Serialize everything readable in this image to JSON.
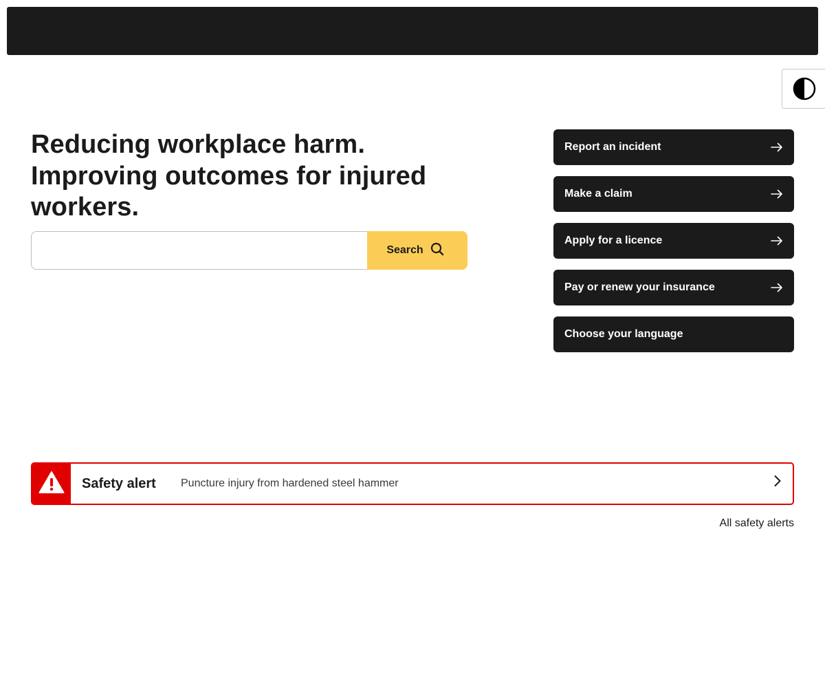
{
  "header": {
    "bar_color": "#1b1b1b"
  },
  "contrast_toggle": {
    "icon": "contrast-icon",
    "label": "Toggle high contrast"
  },
  "hero": {
    "title": "Reducing workplace harm. Improving outcomes for injured workers."
  },
  "search": {
    "value": "",
    "placeholder": "",
    "button_label": "Search",
    "button_icon": "search-icon",
    "button_color": "#fccd56"
  },
  "quick_links": [
    {
      "label": "Report an incident",
      "icon": "arrow-right-icon"
    },
    {
      "label": "Make a claim",
      "icon": "arrow-right-icon"
    },
    {
      "label": "Apply for a licence",
      "icon": "arrow-right-icon"
    },
    {
      "label": "Pay or renew your insurance",
      "icon": "arrow-right-icon"
    },
    {
      "label": "Choose your language",
      "icon": null
    }
  ],
  "safety_alert": {
    "icon": "warning-icon",
    "title": "Safety alert",
    "text": "Puncture injury from hardened steel hammer",
    "chevron_icon": "chevron-right-icon",
    "accent_color": "#e10000"
  },
  "all_alerts_link": {
    "label": "All safety alerts"
  }
}
